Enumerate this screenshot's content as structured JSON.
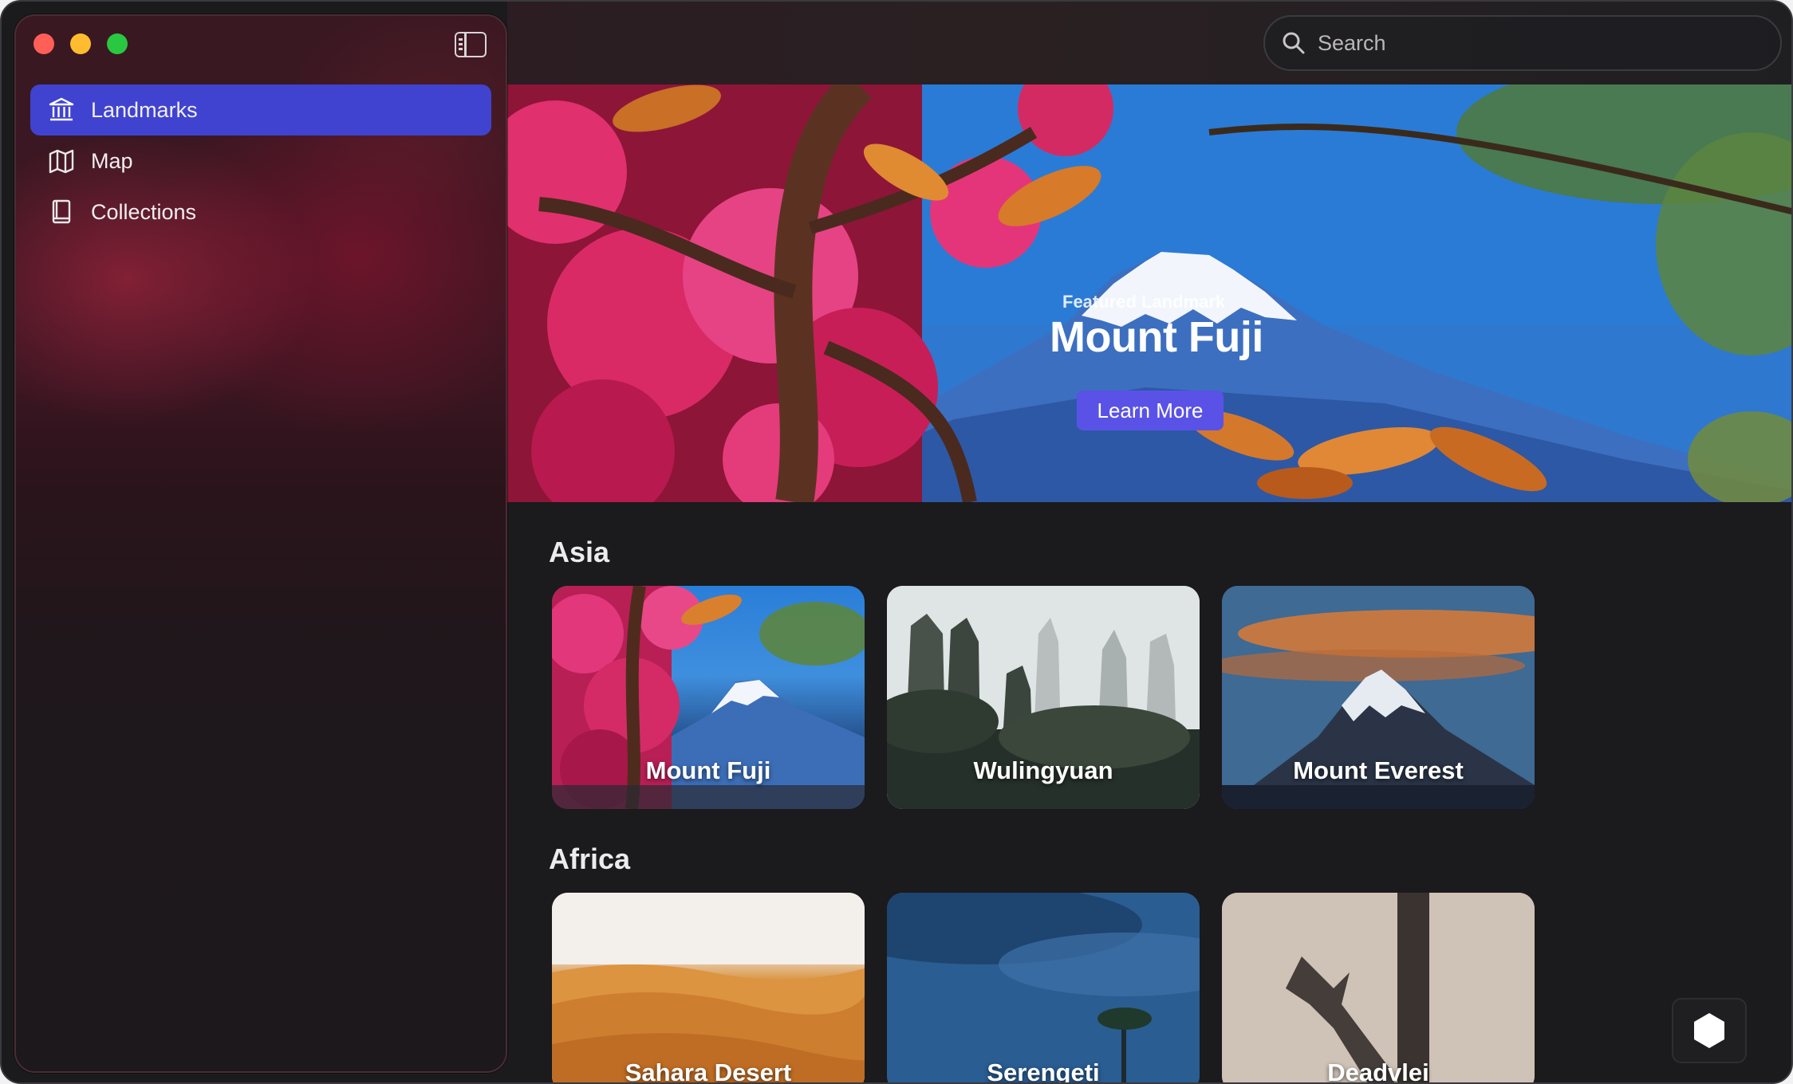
{
  "window": {
    "controls": [
      "close",
      "minimize",
      "zoom"
    ]
  },
  "sidebar": {
    "toggle_icon": "sidebar-toggle-icon",
    "items": [
      {
        "label": "Landmarks",
        "icon": "building-columns-icon",
        "active": true
      },
      {
        "label": "Map",
        "icon": "map-icon",
        "active": false
      },
      {
        "label": "Collections",
        "icon": "book-icon",
        "active": false
      }
    ]
  },
  "search": {
    "placeholder": "Search",
    "icon": "search-icon"
  },
  "hero": {
    "kicker": "Featured Landmark",
    "title": "Mount Fuji",
    "button_label": "Learn More"
  },
  "sections": [
    {
      "title": "Asia",
      "cards": [
        {
          "label": "Mount Fuji"
        },
        {
          "label": "Wulingyuan"
        },
        {
          "label": "Mount Everest"
        }
      ]
    },
    {
      "title": "Africa",
      "cards": [
        {
          "label": "Sahara Desert"
        },
        {
          "label": "Serengeti"
        },
        {
          "label": "Deadvlei"
        }
      ]
    }
  ],
  "colors": {
    "accent": "#3f43cf",
    "button": "#5a52e6",
    "background": "#1b1a1d"
  }
}
